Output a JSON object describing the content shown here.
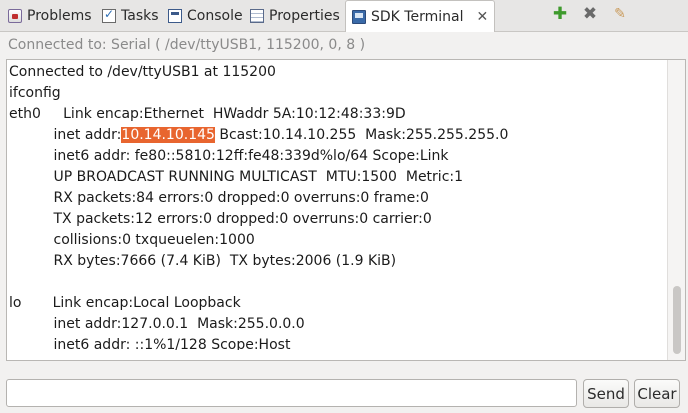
{
  "tabs": [
    {
      "label": "Problems",
      "icon": "problems-icon"
    },
    {
      "label": "Tasks",
      "icon": "tasks-icon"
    },
    {
      "label": "Console",
      "icon": "console-icon"
    },
    {
      "label": "Properties",
      "icon": "properties-icon"
    },
    {
      "label": "SDK Terminal",
      "icon": "sdk-terminal-icon",
      "close": "✕",
      "active": true
    }
  ],
  "toolbar": {
    "add_icon": "add-icon",
    "remove_icon": "remove-icon",
    "clear_icon": "clear-eraser-icon"
  },
  "status": "Connected to: Serial ( /dev/ttyUSB1, 115200, 0, 8 )",
  "terminal": {
    "lines": [
      "Connected to /dev/ttyUSB1 at 115200",
      "ifconfig",
      "eth0     Link encap:Ethernet  HWaddr 5A:10:12:48:33:9D",
      "          inet addr:",
      "          inet6 addr: fe80::5810:12ff:fe48:339d%lo/64 Scope:Link",
      "          UP BROADCAST RUNNING MULTICAST  MTU:1500  Metric:1",
      "          RX packets:84 errors:0 dropped:0 overruns:0 frame:0",
      "          TX packets:12 errors:0 dropped:0 overruns:0 carrier:0",
      "          collisions:0 txqueuelen:1000",
      "          RX bytes:7666 (7.4 KiB)  TX bytes:2006 (1.9 KiB)",
      "",
      "lo       Link encap:Local Loopback",
      "          inet addr:127.0.0.1  Mask:255.0.0.0",
      "          inet6 addr: ::1%1/128 Scope:Host"
    ],
    "selected_ip": "10.14.10.145",
    "after_selection": " Bcast:10.14.10.255  Mask:255.255.255.0",
    "selection_color": "#e8652f"
  },
  "input": {
    "value": "",
    "placeholder": ""
  },
  "buttons": {
    "send": "Send",
    "clear": "Clear"
  }
}
